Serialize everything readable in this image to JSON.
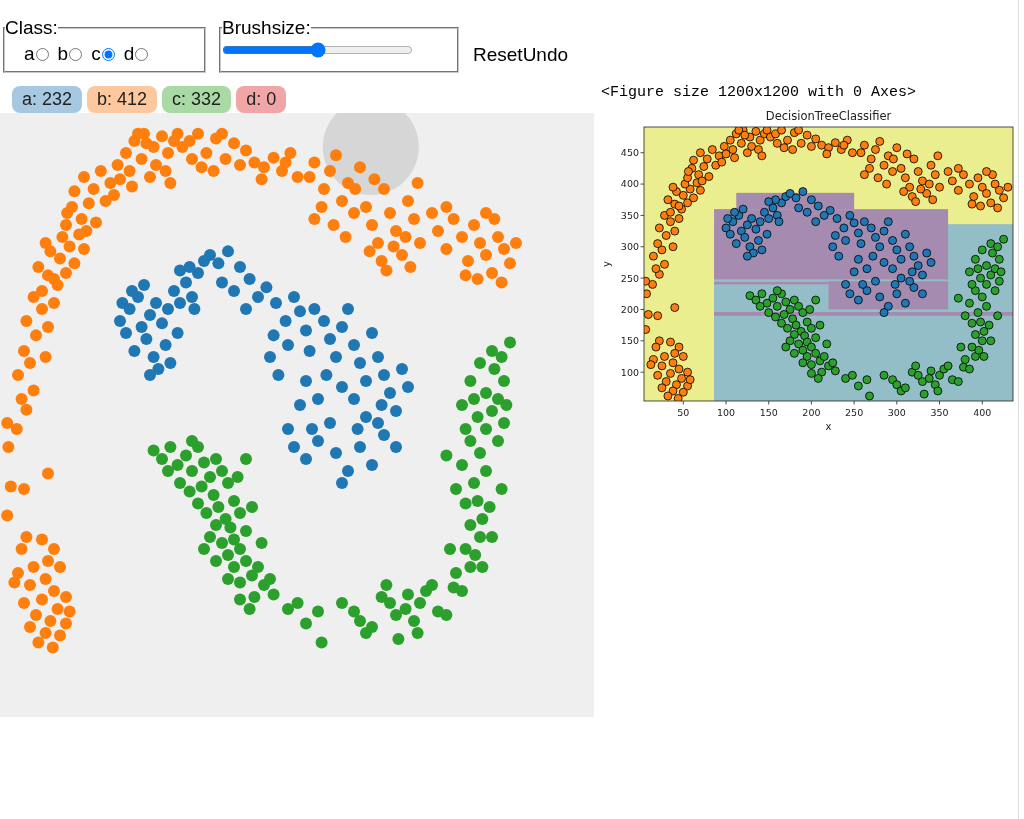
{
  "class_selector": {
    "legend": "Class:",
    "options": [
      {
        "label": "a",
        "selected": false
      },
      {
        "label": "b",
        "selected": false
      },
      {
        "label": "c",
        "selected": true
      },
      {
        "label": "d",
        "selected": false
      }
    ]
  },
  "brushsize": {
    "legend": "Brushsize:",
    "level": 0.5
  },
  "buttons": [
    {
      "label": "Reset"
    },
    {
      "label": "Undo"
    }
  ],
  "counts": [
    {
      "label": "a: 232",
      "color": "#a6c8e1"
    },
    {
      "label": "b: 412",
      "color": "#fdc89e"
    },
    {
      "label": "c: 332",
      "color": "#a9d9a5"
    },
    {
      "label": "d: 0",
      "color": "#f0a5a6"
    }
  ],
  "figure": {
    "caption": "<Figure size 1200x1200 with 0 Axes>",
    "chart_data": {
      "type": "scatter",
      "title": "DecisionTreeClassifier",
      "xlabel": "x",
      "ylabel": "y",
      "xlim": [
        4,
        436
      ],
      "ylim": [
        54,
        491
      ],
      "xticks": [
        {
          "value": 50,
          "label": "50"
        },
        {
          "value": 100,
          "label": "100"
        },
        {
          "value": 150,
          "label": "150"
        },
        {
          "value": 200,
          "label": "200"
        },
        {
          "value": 250,
          "label": "250"
        },
        {
          "value": 300,
          "label": "300"
        },
        {
          "value": 350,
          "label": "350"
        },
        {
          "value": 400,
          "label": "400"
        }
      ],
      "yticks": [
        {
          "value": 100,
          "label": "100"
        },
        {
          "value": 150,
          "label": "150"
        },
        {
          "value": 200,
          "label": "200"
        },
        {
          "value": 250,
          "label": "250"
        },
        {
          "value": 300,
          "label": "300"
        },
        {
          "value": 350,
          "label": "350"
        },
        {
          "value": 400,
          "label": "400"
        },
        {
          "value": 450,
          "label": "450"
        }
      ],
      "series": [
        {
          "color": "#1f77b4",
          "x": [
            100,
            108,
            115,
            105,
            118,
            125,
            130,
            122,
            135,
            140,
            112,
            128,
            138,
            145,
            150,
            155,
            148,
            132,
            142,
            120,
            110,
            160,
            165,
            170,
            158,
            175,
            150,
            162,
            125,
            102,
            182,
            190,
            200,
            208,
            195,
            185,
            215,
            205,
            222,
            230,
            238,
            245,
            250,
            228,
            240,
            255,
            262,
            270,
            258,
            275,
            285,
            290,
            280,
            295,
            300,
            310,
            305,
            315,
            320,
            325,
            335,
            340,
            330,
            318,
            305,
            295,
            285,
            272,
            265,
            255,
            250,
            240,
            245,
            255,
            265,
            275,
            280,
            290,
            300,
            310,
            320,
            330,
            285,
            260,
            232,
            225,
            298,
            315
          ],
          "values": [
            330,
            340,
            350,
            320,
            325,
            335,
            345,
            315,
            328,
            340,
            305,
            300,
            310,
            355,
            345,
            362,
            320,
            290,
            295,
            360,
            355,
            350,
            370,
            380,
            375,
            385,
            372,
            340,
            285,
            345,
            378,
            388,
            375,
            365,
            355,
            362,
            350,
            340,
            358,
            345,
            330,
            350,
            338,
            318,
            310,
            322,
            340,
            330,
            305,
            315,
            325,
            340,
            300,
            310,
            295,
            320,
            280,
            300,
            285,
            270,
            290,
            275,
            255,
            260,
            250,
            265,
            275,
            285,
            265,
            280,
            260,
            240,
            225,
            215,
            230,
            245,
            220,
            205,
            225,
            210,
            235,
            225,
            195,
            240,
            285,
            300,
            240,
            245
          ]
        },
        {
          "color": "#ff7f0e",
          "x": [
            22,
            35,
            45,
            40,
            28,
            15,
            50,
            38,
            25,
            45,
            55,
            35,
            20,
            48,
            30,
            42,
            55,
            25,
            38,
            50,
            32,
            44,
            18,
            12,
            58,
            6,
            9,
            20,
            40,
            7,
            14,
            6,
            22,
            18,
            28,
            15,
            25,
            38,
            20,
            30,
            40,
            22,
            35,
            45,
            28,
            35,
            48,
            40,
            55,
            32,
            50,
            62,
            42,
            58,
            70,
            38,
            52,
            66,
            45,
            55,
            68,
            80,
            60,
            74,
            88,
            62,
            78,
            92,
            70,
            84,
            56,
            95,
            72,
            98,
            105,
            112,
            120,
            108,
            118,
            128,
            135,
            125,
            140,
            145,
            100,
            130,
            115,
            138,
            148,
            122,
            110,
            142,
            152,
            158,
            165,
            172,
            180,
            188,
            195,
            200,
            168,
            185,
            160,
            178,
            205,
            212,
            220,
            228,
            235,
            242,
            248,
            218,
            238,
            258,
            262,
            270,
            275,
            280,
            285,
            290,
            295,
            268,
            278,
            300,
            288,
            262,
            296,
            305,
            310,
            315,
            320,
            325,
            330,
            335,
            340,
            345,
            318,
            328,
            338,
            348,
            312,
            322,
            342,
            350,
            308,
            360,
            365,
            372,
            378,
            385,
            390,
            395,
            400,
            405,
            410,
            415,
            420,
            425,
            430,
            398,
            388,
            412,
            372,
            418,
            405
          ],
          "values": [
            150,
            148,
            140,
            130,
            125,
            120,
            125,
            115,
            110,
            105,
            100,
            98,
            95,
            90,
            85,
            80,
            78,
            75,
            70,
            68,
            62,
            58,
            140,
            112,
            88,
            168,
            192,
            190,
            203,
            225,
            240,
            245,
            256,
            265,
            272,
            285,
            295,
            300,
            305,
            318,
            325,
            330,
            340,
            345,
            350,
            355,
            360,
            368,
            370,
            375,
            382,
            378,
            388,
            392,
            390,
            395,
            400,
            402,
            365,
            410,
            415,
            412,
            425,
            428,
            430,
            438,
            440,
            445,
            450,
            455,
            420,
            435,
            405,
            460,
            470,
            480,
            486,
            455,
            465,
            475,
            484,
            450,
            470,
            480,
            448,
            460,
            486,
            455,
            486,
            478,
            442,
            445,
            475,
            480,
            486,
            470,
            482,
            465,
            478,
            460,
            458,
            486,
            465,
            455,
            472,
            462,
            458,
            466,
            455,
            470,
            450,
            448,
            462,
            450,
            462,
            440,
            455,
            468,
            430,
            445,
            420,
            425,
            410,
            458,
            400,
            415,
            440,
            425,
            410,
            395,
            440,
            420,
            405,
            385,
            430,
            415,
            380,
            392,
            400,
            445,
            448,
            372,
            375,
            395,
            388,
            420,
            405,
            390,
            415,
            400,
            380,
            410,
            395,
            385,
            370,
            400,
            390,
            378,
            395,
            365,
            368,
            415,
            425,
            362,
            420
          ]
        },
        {
          "color": "#2ca02c",
          "x": [
            128,
            135,
            142,
            148,
            155,
            160,
            165,
            170,
            175,
            150,
            158,
            168,
            180,
            185,
            190,
            178,
            165,
            172,
            182,
            188,
            195,
            200,
            192,
            180,
            175,
            185,
            195,
            205,
            200,
            190,
            180,
            195,
            205,
            210,
            200,
            190,
            215,
            220,
            212,
            200,
            225,
            228,
            208,
            160,
            140,
            198,
            205,
            210,
            218,
            170,
            240,
            248,
            255,
            265,
            268,
            285,
            295,
            300,
            305,
            310,
            318,
            325,
            330,
            338,
            332,
            345,
            350,
            355,
            360,
            365,
            348,
            340,
            372,
            378,
            322,
            380,
            385,
            392,
            388,
            396,
            400,
            392,
            402,
            398,
            388,
            408,
            395,
            385,
            380,
            405,
            400,
            392,
            405,
            398,
            410,
            415,
            420,
            412,
            405,
            395,
            400,
            410,
            392,
            418,
            425,
            385,
            415,
            420,
            372,
            375,
            410,
            418,
            402,
            388,
            422
          ],
          "values": [
            222,
            215,
            225,
            210,
            218,
            205,
            225,
            212,
            200,
            195,
            188,
            192,
            215,
            205,
            195,
            185,
            178,
            170,
            175,
            165,
            180,
            170,
            158,
            160,
            150,
            145,
            148,
            155,
            140,
            135,
            130,
            125,
            130,
            118,
            112,
            115,
            125,
            110,
            100,
            98,
            115,
            102,
            90,
            230,
            205,
            200,
            215,
            175,
            145,
            140,
            90,
            95,
            78,
            88,
            62,
            95,
            88,
            80,
            70,
            75,
            100,
            95,
            85,
            90,
            65,
            80,
            95,
            105,
            110,
            88,
            70,
            102,
            85,
            108,
            110,
            120,
            105,
            125,
            140,
            135,
            150,
            160,
            165,
            180,
            178,
            175,
            195,
            210,
            190,
            205,
            220,
            230,
            240,
            250,
            255,
            265,
            280,
            290,
            270,
            265,
            295,
            305,
            280,
            300,
            312,
            260,
            230,
            245,
            218,
            140,
            150,
            190,
            125,
            240,
            260
          ]
        }
      ]
    }
  }
}
